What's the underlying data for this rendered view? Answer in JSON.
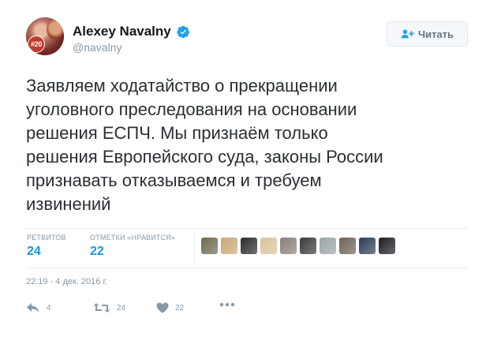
{
  "header": {
    "display_name": "Alexey Navalny",
    "handle": "@navalny",
    "avatar_badge": "#20",
    "follow_label": "Читать"
  },
  "tweet": {
    "text_lines": [
      "Заявляем ходатайство о прекращении",
      "уголовного преследования на основании",
      "решения ЕСПЧ. Мы признаём только",
      "решения Европейского суда, законы России",
      "признавать отказываемся и требуем",
      "извинений"
    ]
  },
  "stats": {
    "retweets_label": "РЕТВИТОВ",
    "retweets_count": "24",
    "likes_label": "ОТМЕТКИ «НРАВИТСЯ»",
    "likes_count": "22"
  },
  "likers": [
    {
      "name": "liker-avatar-1",
      "color": "#6b6a4f"
    },
    {
      "name": "liker-avatar-2",
      "color": "#c9a978"
    },
    {
      "name": "liker-avatar-3",
      "color": "#2b2b2b"
    },
    {
      "name": "liker-avatar-4",
      "color": "#d8c29a"
    },
    {
      "name": "liker-avatar-5",
      "color": "#8a7f78"
    },
    {
      "name": "liker-avatar-6",
      "color": "#3a3a3a"
    },
    {
      "name": "liker-avatar-7",
      "color": "#9aa3a6"
    },
    {
      "name": "liker-avatar-8",
      "color": "#6e6257"
    },
    {
      "name": "liker-avatar-9",
      "color": "#2d3e55"
    },
    {
      "name": "liker-avatar-10",
      "color": "#1d1d24"
    }
  ],
  "timestamp": "22:19 - 4 дек. 2016 г.",
  "actions": {
    "reply_count": "4",
    "retweet_count": "24",
    "like_count": "22"
  },
  "colors": {
    "accent_blue": "#1b95e0",
    "muted_gray": "#8899a6",
    "text": "#292f33"
  }
}
